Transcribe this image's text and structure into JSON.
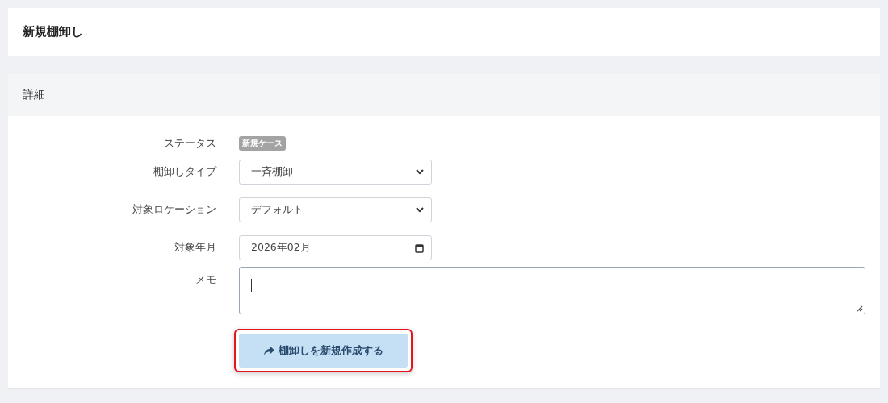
{
  "page_title": "新規棚卸し",
  "section": {
    "title": "詳細",
    "fields": [
      {
        "kind": "badge",
        "label": "ステータス",
        "value": "新規ケース"
      },
      {
        "kind": "select",
        "label": "棚卸しタイプ",
        "value": "一斉棚卸"
      },
      {
        "kind": "select",
        "label": "対象ロケーション",
        "value": "デフォルト"
      },
      {
        "kind": "month",
        "label": "対象年月",
        "value": "2026年02月"
      },
      {
        "kind": "textarea",
        "label": "メモ",
        "focused": true
      }
    ],
    "submit": {
      "label": "棚卸しを新規作成する",
      "highlighted": true
    }
  }
}
